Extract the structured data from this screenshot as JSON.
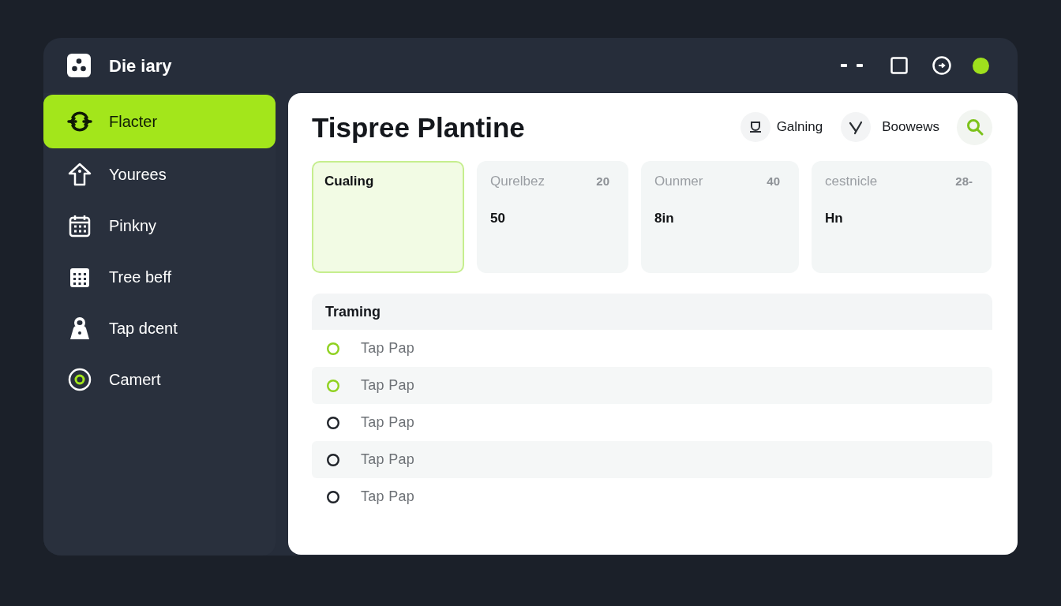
{
  "window": {
    "title": "Die iary"
  },
  "sidebar": {
    "items": [
      {
        "label": "Flacter",
        "selected": true
      },
      {
        "label": "Yourees",
        "selected": false
      },
      {
        "label": "Pinkny",
        "selected": false
      },
      {
        "label": "Tree beff",
        "selected": false
      },
      {
        "label": "Tap dcent",
        "selected": false
      },
      {
        "label": "Camert",
        "selected": false
      }
    ]
  },
  "main": {
    "title": "Tispree Plantine",
    "actions": [
      {
        "label": "Galning"
      },
      {
        "label": "Boowews"
      }
    ],
    "cards": [
      {
        "title": "Cualing",
        "selected": true
      },
      {
        "title": "Qurelbez",
        "count": "20",
        "value": "50",
        "selected": false
      },
      {
        "title": "Ounmer",
        "count": "40",
        "value": "8in",
        "selected": false
      },
      {
        "title": "cestnicle",
        "count": "28-",
        "value": "Hn",
        "selected": false
      }
    ],
    "list": {
      "title": "Traming",
      "rows": [
        {
          "label": "Tap Pap",
          "color": "#8fd11f"
        },
        {
          "label": "Tap Pap",
          "color": "#8fd11f"
        },
        {
          "label": "Tap Pap",
          "color": "#1f2329"
        },
        {
          "label": "Tap Pap",
          "color": "#1f2329"
        },
        {
          "label": "Tap Pap",
          "color": "#1f2329"
        }
      ]
    }
  }
}
